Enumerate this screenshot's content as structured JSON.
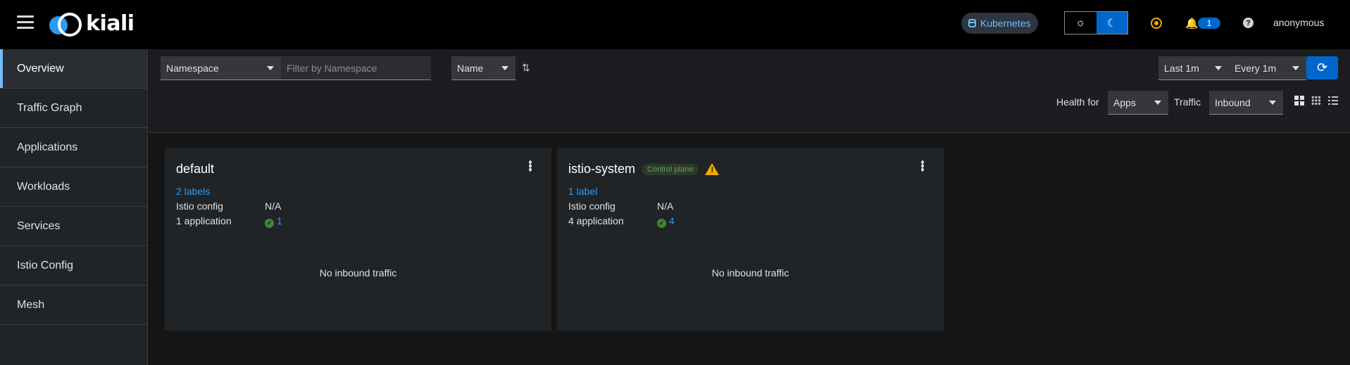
{
  "header": {
    "logo_text": "kiali",
    "cluster_badge": "Kubernetes",
    "notification_count": "1",
    "help_glyph": "?",
    "user": "anonymous",
    "theme_light_glyph": "☼",
    "theme_dark_glyph": "☾",
    "bell_glyph": "🔔"
  },
  "sidebar": {
    "items": [
      {
        "label": "Overview",
        "active": true
      },
      {
        "label": "Traffic Graph"
      },
      {
        "label": "Applications"
      },
      {
        "label": "Workloads"
      },
      {
        "label": "Services"
      },
      {
        "label": "Istio Config"
      },
      {
        "label": "Mesh"
      }
    ]
  },
  "toolbar": {
    "filter_type": "Namespace",
    "filter_placeholder": "Filter by Namespace",
    "sort_by": "Name",
    "sort_glyph": "⇅",
    "duration": "Last 1m",
    "refresh_interval": "Every 1m",
    "refresh_glyph": "⟳",
    "health_for_label": "Health for",
    "health_for_value": "Apps",
    "traffic_label": "Traffic",
    "traffic_value": "Inbound"
  },
  "cards": [
    {
      "title": "default",
      "labels_link": "2 labels",
      "istio_config_label": "Istio config",
      "istio_config_value": "N/A",
      "apps_label": "1 application",
      "apps_count": "1",
      "traffic_message": "No inbound traffic"
    },
    {
      "title": "istio-system",
      "badge": "Control plane",
      "labels_link": "1 label",
      "istio_config_label": "Istio config",
      "istio_config_value": "N/A",
      "apps_label": "4 application",
      "apps_count": "4",
      "traffic_message": "No inbound traffic"
    }
  ],
  "colors": {
    "accent": "#0066cc",
    "link": "#2b9af3",
    "success": "#3e8635",
    "warning": "#f0ab00"
  }
}
